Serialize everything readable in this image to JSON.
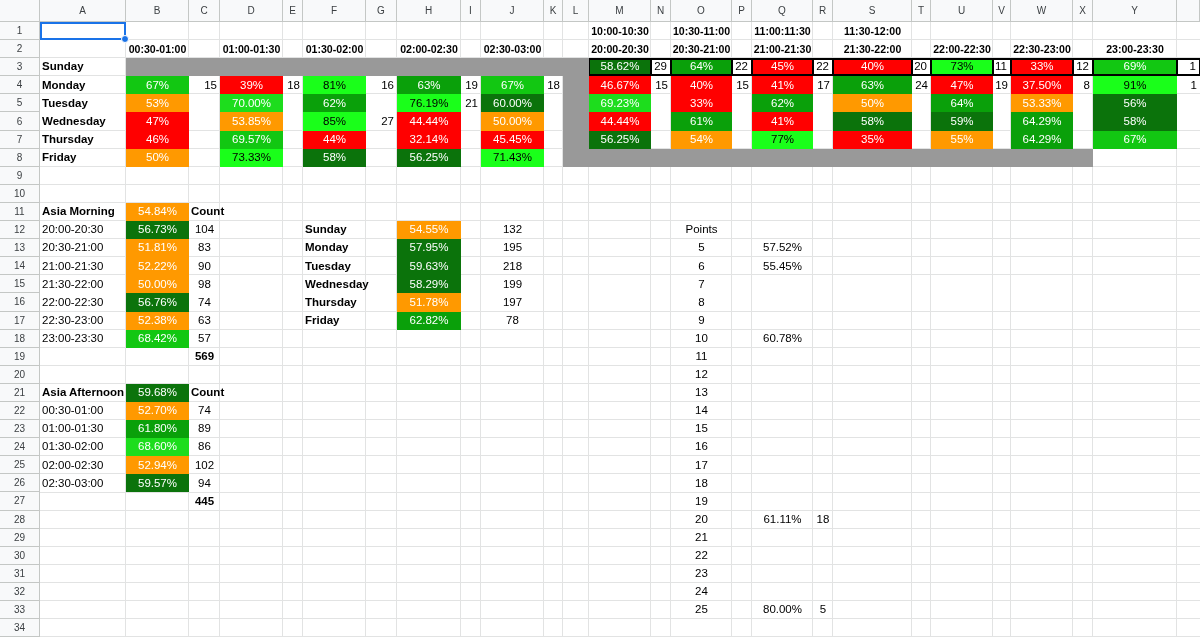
{
  "sheet": {
    "columns": [
      "A",
      "B",
      "C",
      "D",
      "E",
      "F",
      "G",
      "H",
      "I",
      "J",
      "K",
      "L",
      "M",
      "N",
      "O",
      "P",
      "Q",
      "R",
      "S",
      "T",
      "U",
      "V",
      "W",
      "X",
      "Y"
    ],
    "rows": [
      {
        "number": "1",
        "cells": [
          {
            "kind": "active"
          },
          null,
          null,
          null,
          null,
          null,
          null,
          null,
          null,
          null,
          null,
          null,
          {
            "kind": "header",
            "text": "10:00-10:30"
          },
          null,
          {
            "kind": "header",
            "text": "10:30-11:00"
          },
          null,
          {
            "kind": "header",
            "text": "11:00:11:30"
          },
          null,
          {
            "kind": "header",
            "text": "11:30-12:00"
          }
        ]
      },
      {
        "number": "2",
        "cells": [
          null,
          {
            "kind": "header",
            "text": "00:30-01:00"
          },
          null,
          {
            "kind": "header",
            "text": "01:00-01:30"
          },
          null,
          {
            "kind": "header",
            "text": "01:30-02:00"
          },
          null,
          {
            "kind": "header",
            "text": "02:00-02:30"
          },
          null,
          {
            "kind": "header",
            "text": "02:30-03:00"
          },
          null,
          null,
          {
            "kind": "header",
            "text": "20:00-20:30"
          },
          null,
          {
            "kind": "header",
            "text": "20:30-21:00"
          },
          null,
          {
            "kind": "header",
            "text": "21:00-21:30"
          },
          null,
          {
            "kind": "header",
            "text": "21:30-22:00"
          },
          null,
          {
            "kind": "header",
            "text": "22:00-22:30"
          },
          null,
          {
            "kind": "header",
            "text": "22:30-23:00"
          },
          null,
          {
            "kind": "header",
            "text": "23:00-23:30"
          }
        ]
      },
      {
        "number": "3",
        "cells": [
          {
            "kind": "label",
            "text": "Sunday"
          },
          {
            "kind": "shade",
            "color": "#999999"
          },
          {
            "kind": "shade",
            "color": "#999999"
          },
          {
            "kind": "shade",
            "color": "#999999"
          },
          {
            "kind": "shade",
            "color": "#999999"
          },
          {
            "kind": "shade",
            "color": "#999999"
          },
          {
            "kind": "shade",
            "color": "#999999"
          },
          {
            "kind": "shade",
            "color": "#999999"
          },
          {
            "kind": "shade",
            "color": "#999999"
          },
          {
            "kind": "shade",
            "color": "#999999"
          },
          {
            "kind": "shade",
            "color": "#999999"
          },
          {
            "kind": "shade",
            "color": "#999999"
          },
          {
            "kind": "framed",
            "text": "58.62%",
            "color": "#0b730b"
          },
          {
            "kind": "framedcount",
            "text": "29"
          },
          {
            "kind": "framed",
            "text": "64%",
            "color": "#0aa00a"
          },
          {
            "kind": "framedcount",
            "text": "22"
          },
          {
            "kind": "framed",
            "text": "45%",
            "color": "#ff0000"
          },
          {
            "kind": "framedcount",
            "text": "22"
          },
          {
            "kind": "framed",
            "text": "40%",
            "color": "#ff0000"
          },
          {
            "kind": "framedcount",
            "text": "20"
          },
          {
            "kind": "framed",
            "text": "73%",
            "color": "#1aff1a"
          },
          {
            "kind": "framedcount",
            "text": "11"
          },
          {
            "kind": "framed",
            "text": "33%",
            "color": "#ff0000"
          },
          {
            "kind": "framedcount",
            "text": "12"
          },
          {
            "kind": "framed",
            "text": "69%",
            "color": "#12c712"
          },
          {
            "kind": "framedcount",
            "text": "1"
          }
        ]
      },
      {
        "number": "4",
        "cells": [
          {
            "kind": "label",
            "text": "Monday"
          },
          {
            "kind": "value",
            "text": "67%",
            "color": "#12c712"
          },
          {
            "kind": "count",
            "text": "15"
          },
          {
            "kind": "value",
            "text": "39%",
            "color": "#ff0000"
          },
          {
            "kind": "count",
            "text": "18"
          },
          {
            "kind": "value",
            "text": "81%",
            "color": "#1aff1a"
          },
          {
            "kind": "count",
            "text": "16"
          },
          {
            "kind": "value",
            "text": "63%",
            "color": "#0aa00a"
          },
          {
            "kind": "count",
            "text": "19"
          },
          {
            "kind": "value",
            "text": "67%",
            "color": "#12c712"
          },
          {
            "kind": "count",
            "text": "18"
          },
          {
            "kind": "shade",
            "color": "#999999"
          },
          {
            "kind": "value",
            "text": "46.67%",
            "color": "#ff0000"
          },
          {
            "kind": "count",
            "text": "15"
          },
          {
            "kind": "value",
            "text": "40%",
            "color": "#ff0000"
          },
          {
            "kind": "count",
            "text": "15"
          },
          {
            "kind": "value",
            "text": "41%",
            "color": "#ff0000"
          },
          {
            "kind": "count",
            "text": "17"
          },
          {
            "kind": "value",
            "text": "63%",
            "color": "#0aa00a"
          },
          {
            "kind": "count",
            "text": "24"
          },
          {
            "kind": "value",
            "text": "47%",
            "color": "#ff0000"
          },
          {
            "kind": "count",
            "text": "19"
          },
          {
            "kind": "value",
            "text": "37.50%",
            "color": "#ff0000"
          },
          {
            "kind": "count",
            "text": "8"
          },
          {
            "kind": "value",
            "text": "91%",
            "color": "#1aff1a"
          },
          {
            "kind": "count",
            "text": "1"
          }
        ]
      },
      {
        "number": "5",
        "cells": [
          {
            "kind": "label",
            "text": "Tuesday"
          },
          {
            "kind": "value",
            "text": "53%",
            "color": "#ff9900"
          },
          null,
          {
            "kind": "value",
            "text": "70.00%",
            "color": "#1ddd1d"
          },
          null,
          {
            "kind": "value",
            "text": "62%",
            "color": "#0aa00a"
          },
          null,
          {
            "kind": "value",
            "text": "76.19%",
            "color": "#1aff1a"
          },
          {
            "kind": "count",
            "text": "21"
          },
          {
            "kind": "value",
            "text": "60.00%",
            "color": "#0b730b"
          },
          null,
          {
            "kind": "shade",
            "color": "#999999"
          },
          {
            "kind": "value",
            "text": "69.23%",
            "color": "#1ddd1d"
          },
          null,
          {
            "kind": "value",
            "text": "33%",
            "color": "#ff0000"
          },
          null,
          {
            "kind": "value",
            "text": "62%",
            "color": "#0aa00a"
          },
          null,
          {
            "kind": "value",
            "text": "50%",
            "color": "#ff9900"
          },
          null,
          {
            "kind": "value",
            "text": "64%",
            "color": "#0aa00a"
          },
          null,
          {
            "kind": "value",
            "text": "53.33%",
            "color": "#ff9900"
          },
          null,
          {
            "kind": "value",
            "text": "56%",
            "color": "#0b730b"
          }
        ]
      },
      {
        "number": "6",
        "cells": [
          {
            "kind": "label",
            "text": "Wednesday"
          },
          {
            "kind": "value",
            "text": "47%",
            "color": "#ff0000"
          },
          null,
          {
            "kind": "value",
            "text": "53.85%",
            "color": "#ff9900"
          },
          null,
          {
            "kind": "value",
            "text": "85%",
            "color": "#1aff1a"
          },
          {
            "kind": "count",
            "text": "27"
          },
          {
            "kind": "value",
            "text": "44.44%",
            "color": "#ff0000"
          },
          null,
          {
            "kind": "value",
            "text": "50.00%",
            "color": "#ff9900"
          },
          null,
          {
            "kind": "shade",
            "color": "#999999"
          },
          {
            "kind": "value",
            "text": "44.44%",
            "color": "#ff0000"
          },
          null,
          {
            "kind": "value",
            "text": "61%",
            "color": "#0aa00a"
          },
          null,
          {
            "kind": "value",
            "text": "41%",
            "color": "#ff0000"
          },
          null,
          {
            "kind": "value",
            "text": "58%",
            "color": "#0b730b"
          },
          null,
          {
            "kind": "value",
            "text": "59%",
            "color": "#0b730b"
          },
          null,
          {
            "kind": "value",
            "text": "64.29%",
            "color": "#0aa00a"
          },
          null,
          {
            "kind": "value",
            "text": "58%",
            "color": "#0b730b"
          }
        ]
      },
      {
        "number": "7",
        "cells": [
          {
            "kind": "label",
            "text": "Thursday"
          },
          {
            "kind": "value",
            "text": "46%",
            "color": "#ff0000"
          },
          null,
          {
            "kind": "value",
            "text": "69.57%",
            "color": "#12c712"
          },
          null,
          {
            "kind": "value",
            "text": "44%",
            "color": "#ff0000"
          },
          null,
          {
            "kind": "value",
            "text": "32.14%",
            "color": "#ff0000"
          },
          null,
          {
            "kind": "value",
            "text": "45.45%",
            "color": "#ff0000"
          },
          null,
          {
            "kind": "shade",
            "color": "#999999"
          },
          {
            "kind": "value",
            "text": "56.25%",
            "color": "#0b730b"
          },
          null,
          {
            "kind": "value",
            "text": "54%",
            "color": "#ff9900"
          },
          null,
          {
            "kind": "value",
            "text": "77%",
            "color": "#1aff1a"
          },
          null,
          {
            "kind": "value",
            "text": "35%",
            "color": "#ff0000"
          },
          null,
          {
            "kind": "value",
            "text": "55%",
            "color": "#ff9900"
          },
          null,
          {
            "kind": "value",
            "text": "64.29%",
            "color": "#0aa00a"
          },
          null,
          {
            "kind": "value",
            "text": "67%",
            "color": "#12c712"
          }
        ]
      },
      {
        "number": "8",
        "cells": [
          {
            "kind": "label",
            "text": "Friday"
          },
          {
            "kind": "value",
            "text": "50%",
            "color": "#ff9900"
          },
          null,
          {
            "kind": "value",
            "text": "73.33%",
            "color": "#1aff1a"
          },
          null,
          {
            "kind": "value",
            "text": "58%",
            "color": "#0b730b"
          },
          null,
          {
            "kind": "value",
            "text": "56.25%",
            "color": "#0b730b"
          },
          null,
          {
            "kind": "value",
            "text": "71.43%",
            "color": "#1aff1a"
          },
          null,
          {
            "kind": "shade",
            "color": "#999999"
          },
          {
            "kind": "shade",
            "color": "#999999"
          },
          {
            "kind": "shade",
            "color": "#999999"
          },
          {
            "kind": "shade",
            "color": "#999999"
          },
          {
            "kind": "shade",
            "color": "#999999"
          },
          {
            "kind": "shade",
            "color": "#999999"
          },
          {
            "kind": "shade",
            "color": "#999999"
          },
          {
            "kind": "shade",
            "color": "#999999"
          },
          {
            "kind": "shade",
            "color": "#999999"
          },
          {
            "kind": "shade",
            "color": "#999999"
          },
          {
            "kind": "shade",
            "color": "#999999"
          },
          {
            "kind": "shade",
            "color": "#999999"
          },
          {
            "kind": "shade",
            "color": "#999999"
          }
        ]
      },
      {
        "number": "9"
      },
      {
        "number": "10"
      },
      {
        "number": "11",
        "cells": [
          {
            "kind": "label",
            "text": "Asia Morning"
          },
          {
            "kind": "value",
            "text": "54.84%",
            "color": "#ff9900"
          },
          {
            "kind": "label",
            "text": "Count"
          }
        ]
      },
      {
        "number": "12",
        "cells": [
          {
            "kind": "text",
            "text": "20:00-20:30"
          },
          {
            "kind": "value",
            "text": "56.73%",
            "color": "#0b730b"
          },
          {
            "kind": "figure",
            "text": "104"
          },
          null,
          null,
          {
            "kind": "label",
            "text": "Sunday"
          },
          null,
          {
            "kind": "value",
            "text": "54.55%",
            "color": "#ff9900"
          },
          null,
          {
            "kind": "figure",
            "text": "132"
          },
          null,
          null,
          null,
          null,
          {
            "kind": "figure",
            "text": "Points"
          }
        ]
      },
      {
        "number": "13",
        "cells": [
          {
            "kind": "text",
            "text": "20:30-21:00"
          },
          {
            "kind": "value",
            "text": "51.81%",
            "color": "#ff9900"
          },
          {
            "kind": "figure",
            "text": "83"
          },
          null,
          null,
          {
            "kind": "label",
            "text": "Monday"
          },
          null,
          {
            "kind": "value",
            "text": "57.95%",
            "color": "#0b730b"
          },
          null,
          {
            "kind": "figure",
            "text": "195"
          },
          null,
          null,
          null,
          null,
          {
            "kind": "figure",
            "text": "5"
          },
          null,
          {
            "kind": "figure",
            "text": "57.52%"
          }
        ]
      },
      {
        "number": "14",
        "cells": [
          {
            "kind": "text",
            "text": "21:00-21:30"
          },
          {
            "kind": "value",
            "text": "52.22%",
            "color": "#ff9900"
          },
          {
            "kind": "figure",
            "text": "90"
          },
          null,
          null,
          {
            "kind": "label",
            "text": "Tuesday"
          },
          null,
          {
            "kind": "value",
            "text": "59.63%",
            "color": "#0b730b"
          },
          null,
          {
            "kind": "figure",
            "text": "218"
          },
          null,
          null,
          null,
          null,
          {
            "kind": "figure",
            "text": "6"
          },
          null,
          {
            "kind": "figure",
            "text": "55.45%"
          }
        ]
      },
      {
        "number": "15",
        "cells": [
          {
            "kind": "text",
            "text": "21:30-22:00"
          },
          {
            "kind": "value",
            "text": "50.00%",
            "color": "#ff9900"
          },
          {
            "kind": "figure",
            "text": "98"
          },
          null,
          null,
          {
            "kind": "label",
            "text": "Wednesday"
          },
          null,
          {
            "kind": "value",
            "text": "58.29%",
            "color": "#0b730b"
          },
          null,
          {
            "kind": "figure",
            "text": "199"
          },
          null,
          null,
          null,
          null,
          {
            "kind": "figure",
            "text": "7"
          }
        ]
      },
      {
        "number": "16",
        "cells": [
          {
            "kind": "text",
            "text": "22:00-22:30"
          },
          {
            "kind": "value",
            "text": "56.76%",
            "color": "#0b730b"
          },
          {
            "kind": "figure",
            "text": "74"
          },
          null,
          null,
          {
            "kind": "label",
            "text": "Thursday"
          },
          null,
          {
            "kind": "value",
            "text": "51.78%",
            "color": "#ff9900"
          },
          null,
          {
            "kind": "figure",
            "text": "197"
          },
          null,
          null,
          null,
          null,
          {
            "kind": "figure",
            "text": "8"
          }
        ]
      },
      {
        "number": "17",
        "cells": [
          {
            "kind": "text",
            "text": "22:30-23:00"
          },
          {
            "kind": "value",
            "text": "52.38%",
            "color": "#ff9900"
          },
          {
            "kind": "figure",
            "text": "63"
          },
          null,
          null,
          {
            "kind": "label",
            "text": "Friday"
          },
          null,
          {
            "kind": "value",
            "text": "62.82%",
            "color": "#0aa00a"
          },
          null,
          {
            "kind": "figure",
            "text": "78"
          },
          null,
          null,
          null,
          null,
          {
            "kind": "figure",
            "text": "9"
          }
        ]
      },
      {
        "number": "18",
        "cells": [
          {
            "kind": "text",
            "text": "23:00-23:30"
          },
          {
            "kind": "value",
            "text": "68.42%",
            "color": "#12c712"
          },
          {
            "kind": "figure",
            "text": "57"
          },
          null,
          null,
          null,
          null,
          null,
          null,
          null,
          null,
          null,
          null,
          null,
          {
            "kind": "figure",
            "text": "10"
          },
          null,
          {
            "kind": "figure",
            "text": "60.78%"
          }
        ]
      },
      {
        "number": "19",
        "cells": [
          null,
          null,
          {
            "kind": "total",
            "text": "569"
          },
          null,
          null,
          null,
          null,
          null,
          null,
          null,
          null,
          null,
          null,
          null,
          {
            "kind": "figure",
            "text": "11"
          }
        ]
      },
      {
        "number": "20",
        "cells": [
          null,
          null,
          null,
          null,
          null,
          null,
          null,
          null,
          null,
          null,
          null,
          null,
          null,
          null,
          {
            "kind": "figure",
            "text": "12"
          }
        ]
      },
      {
        "number": "21",
        "cells": [
          {
            "kind": "label",
            "text": "Asia Afternoon"
          },
          {
            "kind": "value",
            "text": "59.68%",
            "color": "#0b730b"
          },
          {
            "kind": "label",
            "text": "Count"
          },
          null,
          null,
          null,
          null,
          null,
          null,
          null,
          null,
          null,
          null,
          null,
          {
            "kind": "figure",
            "text": "13"
          }
        ]
      },
      {
        "number": "22",
        "cells": [
          {
            "kind": "text",
            "text": "00:30-01:00"
          },
          {
            "kind": "value",
            "text": "52.70%",
            "color": "#ff9900"
          },
          {
            "kind": "figure",
            "text": "74"
          },
          null,
          null,
          null,
          null,
          null,
          null,
          null,
          null,
          null,
          null,
          null,
          {
            "kind": "figure",
            "text": "14"
          }
        ]
      },
      {
        "number": "23",
        "cells": [
          {
            "kind": "text",
            "text": "01:00-01:30"
          },
          {
            "kind": "value",
            "text": "61.80%",
            "color": "#0aa00a"
          },
          {
            "kind": "figure",
            "text": "89"
          },
          null,
          null,
          null,
          null,
          null,
          null,
          null,
          null,
          null,
          null,
          null,
          {
            "kind": "figure",
            "text": "15"
          }
        ]
      },
      {
        "number": "24",
        "cells": [
          {
            "kind": "text",
            "text": "01:30-02:00"
          },
          {
            "kind": "value",
            "text": "68.60%",
            "color": "#1ddd1d"
          },
          {
            "kind": "figure",
            "text": "86"
          },
          null,
          null,
          null,
          null,
          null,
          null,
          null,
          null,
          null,
          null,
          null,
          {
            "kind": "figure",
            "text": "16"
          }
        ]
      },
      {
        "number": "25",
        "cells": [
          {
            "kind": "text",
            "text": "02:00-02:30"
          },
          {
            "kind": "value",
            "text": "52.94%",
            "color": "#ff9900"
          },
          {
            "kind": "figure",
            "text": "102"
          },
          null,
          null,
          null,
          null,
          null,
          null,
          null,
          null,
          null,
          null,
          null,
          {
            "kind": "figure",
            "text": "17"
          }
        ]
      },
      {
        "number": "26",
        "cells": [
          {
            "kind": "text",
            "text": "02:30-03:00"
          },
          {
            "kind": "value",
            "text": "59.57%",
            "color": "#0b730b"
          },
          {
            "kind": "figure",
            "text": "94"
          },
          null,
          null,
          null,
          null,
          null,
          null,
          null,
          null,
          null,
          null,
          null,
          {
            "kind": "figure",
            "text": "18"
          }
        ]
      },
      {
        "number": "27",
        "cells": [
          null,
          null,
          {
            "kind": "total",
            "text": "445"
          },
          null,
          null,
          null,
          null,
          null,
          null,
          null,
          null,
          null,
          null,
          null,
          {
            "kind": "figure",
            "text": "19"
          }
        ]
      },
      {
        "number": "28",
        "cells": [
          null,
          null,
          null,
          null,
          null,
          null,
          null,
          null,
          null,
          null,
          null,
          null,
          null,
          null,
          {
            "kind": "figure",
            "text": "20"
          },
          null,
          {
            "kind": "figure",
            "text": "61.11%"
          },
          {
            "kind": "figure",
            "text": "18"
          }
        ]
      },
      {
        "number": "29",
        "cells": [
          null,
          null,
          null,
          null,
          null,
          null,
          null,
          null,
          null,
          null,
          null,
          null,
          null,
          null,
          {
            "kind": "figure",
            "text": "21"
          }
        ]
      },
      {
        "number": "30",
        "cells": [
          null,
          null,
          null,
          null,
          null,
          null,
          null,
          null,
          null,
          null,
          null,
          null,
          null,
          null,
          {
            "kind": "figure",
            "text": "22"
          }
        ]
      },
      {
        "number": "31",
        "cells": [
          null,
          null,
          null,
          null,
          null,
          null,
          null,
          null,
          null,
          null,
          null,
          null,
          null,
          null,
          {
            "kind": "figure",
            "text": "23"
          }
        ]
      },
      {
        "number": "32",
        "cells": [
          null,
          null,
          null,
          null,
          null,
          null,
          null,
          null,
          null,
          null,
          null,
          null,
          null,
          null,
          {
            "kind": "figure",
            "text": "24"
          }
        ]
      },
      {
        "number": "33",
        "cells": [
          null,
          null,
          null,
          null,
          null,
          null,
          null,
          null,
          null,
          null,
          null,
          null,
          null,
          null,
          {
            "kind": "figure",
            "text": "25"
          },
          null,
          {
            "kind": "figure",
            "text": "80.00%"
          },
          {
            "kind": "figure",
            "text": "5"
          }
        ]
      },
      {
        "number": "34"
      }
    ]
  }
}
